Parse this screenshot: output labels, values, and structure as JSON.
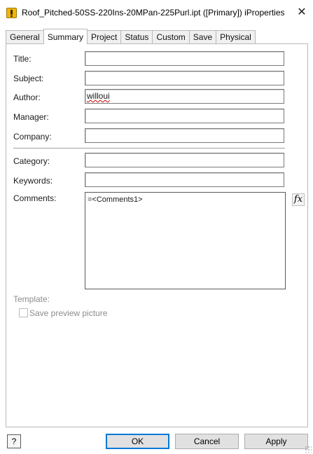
{
  "window": {
    "title": "Roof_Pitched-50SS-220Ins-20MPan-225Purl.ipt ([Primary]) iProperties",
    "close_glyph": "✕"
  },
  "tabs": [
    {
      "label": "General"
    },
    {
      "label": "Summary"
    },
    {
      "label": "Project"
    },
    {
      "label": "Status"
    },
    {
      "label": "Custom"
    },
    {
      "label": "Save"
    },
    {
      "label": "Physical"
    }
  ],
  "fields": {
    "title": {
      "label": "Title:",
      "value": ""
    },
    "subject": {
      "label": "Subject:",
      "value": ""
    },
    "author": {
      "label": "Author:",
      "value": "willoui"
    },
    "manager": {
      "label": "Manager:",
      "value": ""
    },
    "company": {
      "label": "Company:",
      "value": ""
    },
    "category": {
      "label": "Category:",
      "value": ""
    },
    "keywords": {
      "label": "Keywords:",
      "value": ""
    },
    "comments": {
      "label": "Comments:",
      "value": "=<Comments1>"
    }
  },
  "fx_button": {
    "label": "fx"
  },
  "template": {
    "label": "Template:"
  },
  "save_preview": {
    "label": "Save preview picture",
    "checked": false
  },
  "footer": {
    "help_label": "?",
    "ok_label": "OK",
    "cancel_label": "Cancel",
    "apply_label": "Apply"
  }
}
